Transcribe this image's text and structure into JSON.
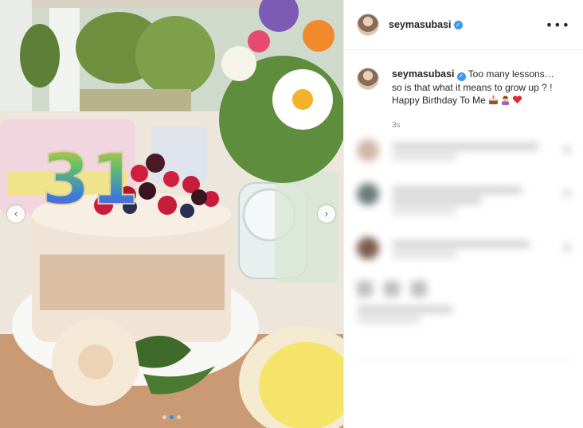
{
  "post": {
    "username": "seymasubasi",
    "verified": true,
    "more_icon": "more-options-icon",
    "caption_text_1": "Too many lessons…",
    "caption_text_2": "so is that what it means to grow up ? !",
    "caption_text_3": "Happy Birthday To Me",
    "caption_emojis": [
      "cake-emoji",
      "woman-emoji",
      "red-heart-emoji"
    ],
    "timestamp": "3s"
  },
  "photo": {
    "candle_digits": "31",
    "carousel_prev": "‹",
    "carousel_next": "›",
    "dots": 3,
    "active_dot": 2
  },
  "colors": {
    "verified_blue": "#3897f0",
    "active_dot": "#2d8cf0",
    "text": "#262626",
    "muted": "#8e8e8e"
  }
}
